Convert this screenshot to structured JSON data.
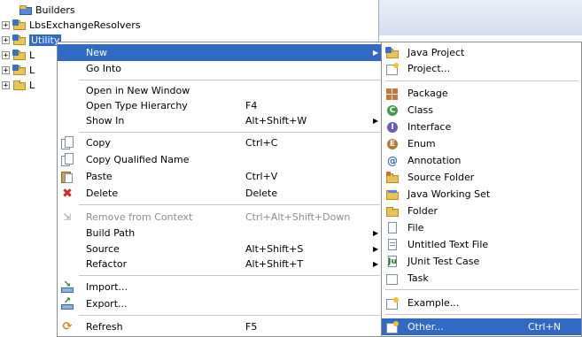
{
  "tree": {
    "items": [
      {
        "label": "Builders"
      },
      {
        "label": "LbsExchangeResolvers"
      },
      {
        "label": "Utility"
      },
      {
        "label": "L"
      },
      {
        "label": "L"
      },
      {
        "label": "L"
      }
    ]
  },
  "context_menu": {
    "items": [
      {
        "label": "New",
        "has_submenu": true,
        "icon": "none"
      },
      {
        "label": "Go Into",
        "icon": "none"
      },
      {
        "label": "Open in New Window",
        "icon": "none"
      },
      {
        "label": "Open Type Hierarchy",
        "accelerator": "F4",
        "icon": "none"
      },
      {
        "label": "Show In",
        "accelerator": "Alt+Shift+W",
        "has_submenu": true,
        "icon": "none"
      },
      {
        "label": "Copy",
        "accelerator": "Ctrl+C",
        "icon": "copy-icon"
      },
      {
        "label": "Copy Qualified Name",
        "icon": "copy-qualified-name-icon"
      },
      {
        "label": "Paste",
        "accelerator": "Ctrl+V",
        "icon": "paste-icon"
      },
      {
        "label": "Delete",
        "accelerator": "Delete",
        "icon": "delete-icon"
      },
      {
        "label": "Remove from Context",
        "accelerator": "Ctrl+Alt+Shift+Down",
        "disabled": true,
        "icon": "remove-context-icon"
      },
      {
        "label": "Build Path",
        "has_submenu": true,
        "icon": "none"
      },
      {
        "label": "Source",
        "accelerator": "Alt+Shift+S",
        "has_submenu": true,
        "icon": "none"
      },
      {
        "label": "Refactor",
        "accelerator": "Alt+Shift+T",
        "has_submenu": true,
        "icon": "none"
      },
      {
        "label": "Import...",
        "icon": "import-icon"
      },
      {
        "label": "Export...",
        "icon": "export-icon"
      },
      {
        "label": "Refresh",
        "accelerator": "F5",
        "icon": "refresh-icon"
      }
    ]
  },
  "new_submenu": {
    "items": [
      {
        "label": "Java Project",
        "icon": "java-project-icon"
      },
      {
        "label": "Project...",
        "icon": "project-icon"
      },
      {
        "label": "Package",
        "icon": "package-icon"
      },
      {
        "label": "Class",
        "icon": "class-icon"
      },
      {
        "label": "Interface",
        "icon": "interface-icon"
      },
      {
        "label": "Enum",
        "icon": "enum-icon"
      },
      {
        "label": "Annotation",
        "icon": "annotation-icon"
      },
      {
        "label": "Source Folder",
        "icon": "source-folder-icon"
      },
      {
        "label": "Java Working Set",
        "icon": "working-set-icon"
      },
      {
        "label": "Folder",
        "icon": "folder-icon"
      },
      {
        "label": "File",
        "icon": "file-icon"
      },
      {
        "label": "Untitled Text File",
        "icon": "text-file-icon"
      },
      {
        "label": "JUnit Test Case",
        "icon": "junit-icon"
      },
      {
        "label": "Task",
        "icon": "task-icon"
      },
      {
        "label": "Example...",
        "icon": "example-icon"
      },
      {
        "label": "Other...",
        "accelerator": "Ctrl+N",
        "icon": "other-icon"
      }
    ]
  },
  "colors": {
    "highlight": "#316ac5",
    "disabled_text": "#8d8d8d",
    "separator": "#c5c5c5"
  }
}
